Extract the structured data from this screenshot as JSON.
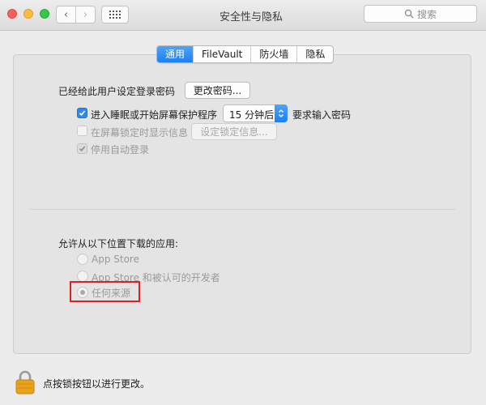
{
  "window": {
    "title": "安全性与隐私",
    "search_placeholder": "搜索",
    "nav_back_glyph": "‹",
    "nav_forward_glyph": "›"
  },
  "tabs": [
    {
      "label": "通用",
      "active": true
    },
    {
      "label": "FileVault",
      "active": false
    },
    {
      "label": "防火墙",
      "active": false
    },
    {
      "label": "隐私",
      "active": false
    }
  ],
  "general": {
    "password_set_label": "已经给此用户设定登录密码",
    "change_password_button": "更改密码...",
    "require_password": {
      "checked": true,
      "label_before": "进入睡眠或开始屏幕保护程序",
      "delay_value": "15 分钟后",
      "label_after": "要求输入密码"
    },
    "show_message": {
      "checked": false,
      "enabled": false,
      "label": "在屏幕锁定时显示信息",
      "button": "设定锁定信息..."
    },
    "disable_auto_login": {
      "checked": true,
      "enabled": false,
      "label": "停用自动登录"
    }
  },
  "downloads": {
    "heading": "允许从以下位置下载的应用:",
    "options": [
      {
        "label": "App Store",
        "selected": false
      },
      {
        "label": "App Store 和被认可的开发者",
        "selected": false
      },
      {
        "label": "任何来源",
        "selected": true
      }
    ]
  },
  "footer": {
    "lock_text": "点按锁按钮以进行更改。"
  },
  "colors": {
    "accent": "#1d7ff4",
    "highlight_box": "#e02020",
    "lock": "#e8a21b"
  },
  "icons": {
    "lock": "lock-icon",
    "search": "search-icon",
    "grid": "grid-icon"
  }
}
